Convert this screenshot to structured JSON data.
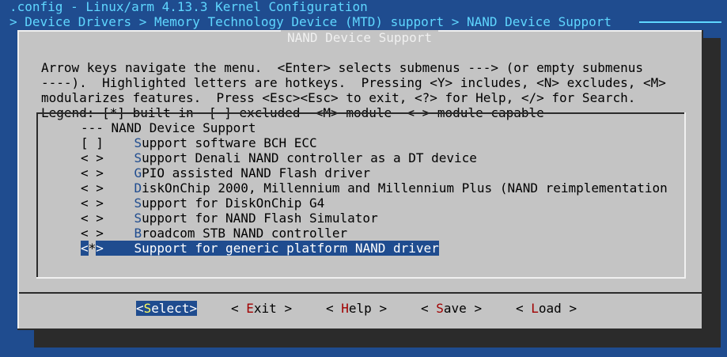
{
  "window": {
    "title": ".config - Linux/arm 4.13.3 Kernel Configuration",
    "breadcrumb": "> Device Drivers > Memory Technology Device (MTD) support > NAND Device Support"
  },
  "dialog": {
    "title": "NAND Device Support",
    "help_lines": [
      "Arrow keys navigate the menu.  <Enter> selects submenus ---> (or empty submenus",
      "----).  Highlighted letters are hotkeys.  Pressing <Y> includes, <N> excludes, <M>",
      "modularizes features.  Press <Esc><Esc> to exit, <?> for Help, </> for Search.",
      "Legend: [*] built-in  [ ] excluded  <M> module  < > module capable"
    ]
  },
  "menu": {
    "header": "--- NAND Device Support",
    "items": [
      {
        "mark": "[ ]",
        "hot": "S",
        "rest": "upport software BCH ECC"
      },
      {
        "mark": "< >",
        "hot": "S",
        "rest": "upport Denali NAND controller as a DT device"
      },
      {
        "mark": "< >",
        "hot": "G",
        "rest": "PIO assisted NAND Flash driver"
      },
      {
        "mark": "< >",
        "hot": "D",
        "rest": "iskOnChip 2000, Millennium and Millennium Plus (NAND reimplementation"
      },
      {
        "mark": "< >",
        "hot": "S",
        "rest": "upport for DiskOnChip G4"
      },
      {
        "mark": "< >",
        "hot": "S",
        "rest": "upport for NAND Flash Simulator"
      },
      {
        "mark": "< >",
        "hot": "B",
        "rest": "roadcom STB NAND controller"
      },
      {
        "mark_open": "<",
        "mark_val": "*",
        "mark_close": ">",
        "hot": "S",
        "rest": "upport for generic platform NAND driver",
        "selected": true
      }
    ]
  },
  "buttons": {
    "select": {
      "open": "<",
      "hot": "S",
      "rest": "elect",
      "close": ">"
    },
    "exit": {
      "open": "< ",
      "hot": "E",
      "rest": "xit",
      "close": " >"
    },
    "help": {
      "open": "< ",
      "hot": "H",
      "rest": "elp",
      "close": " >"
    },
    "save": {
      "open": "< ",
      "hot": "S",
      "rest": "ave",
      "close": " >"
    },
    "load": {
      "open": "< ",
      "hot": "L",
      "rest": "oad",
      "close": " >"
    }
  }
}
